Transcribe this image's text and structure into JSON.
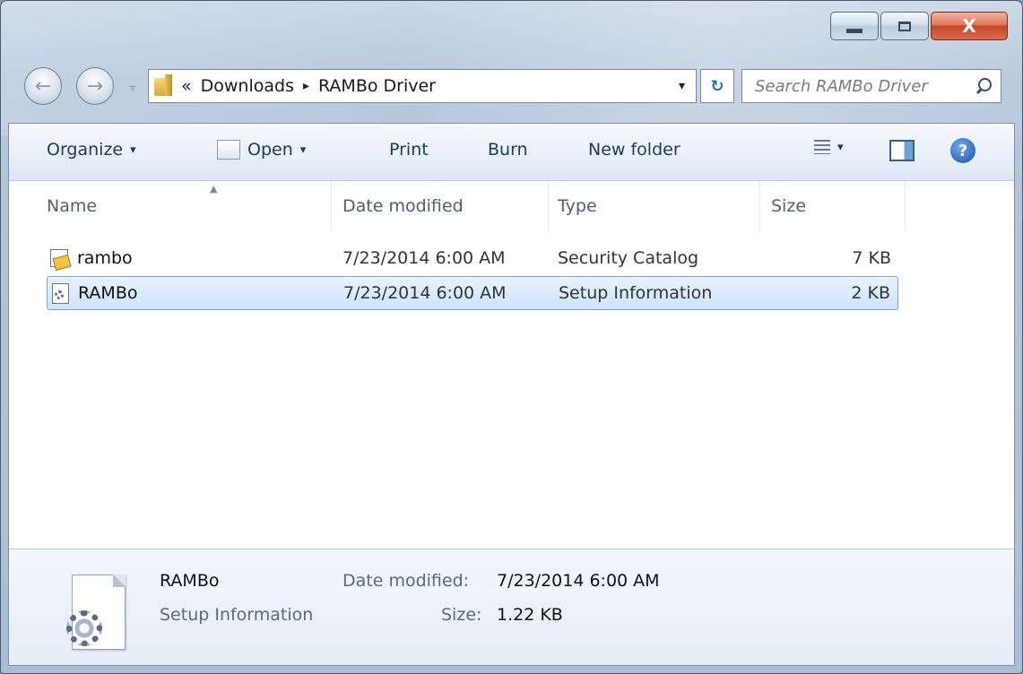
{
  "window": {
    "controls": {
      "close_glyph": "X"
    }
  },
  "nav": {
    "back_glyph": "←",
    "forward_glyph": "→",
    "history_glyph": "▿"
  },
  "address": {
    "overflow_glyph": "«",
    "crumbs": [
      "Downloads",
      "RAMBo Driver"
    ],
    "separator_glyph": "▸",
    "dropdown_glyph": "▾",
    "refresh_glyph": "↻"
  },
  "search": {
    "placeholder": "Search RAMBo Driver"
  },
  "toolbar": {
    "organize": "Organize",
    "open": "Open",
    "print": "Print",
    "burn": "Burn",
    "new_folder": "New folder",
    "caret": "▾",
    "help_glyph": "?"
  },
  "columns": {
    "name": "Name",
    "date_modified": "Date modified",
    "type": "Type",
    "size": "Size",
    "sort_glyph": "▲"
  },
  "files": [
    {
      "name": "rambo",
      "date": "7/23/2014 6:00 AM",
      "type": "Security Catalog",
      "size": "7 KB",
      "icon": "security-catalog-icon"
    },
    {
      "name": "RAMBo",
      "date": "7/23/2014 6:00 AM",
      "type": "Setup Information",
      "size": "2 KB",
      "icon": "setup-information-icon",
      "selected": true
    }
  ],
  "details": {
    "name": "RAMBo",
    "type": "Setup Information",
    "date_label": "Date modified:",
    "date_value": "7/23/2014 6:00 AM",
    "size_label": "Size:",
    "size_value": "1.22 KB"
  },
  "colors": {
    "selection_border": "#7da2ce",
    "selection_fill": "#cfe3fb",
    "close_button": "#c9462b",
    "toolbar_text": "#1e395b"
  }
}
